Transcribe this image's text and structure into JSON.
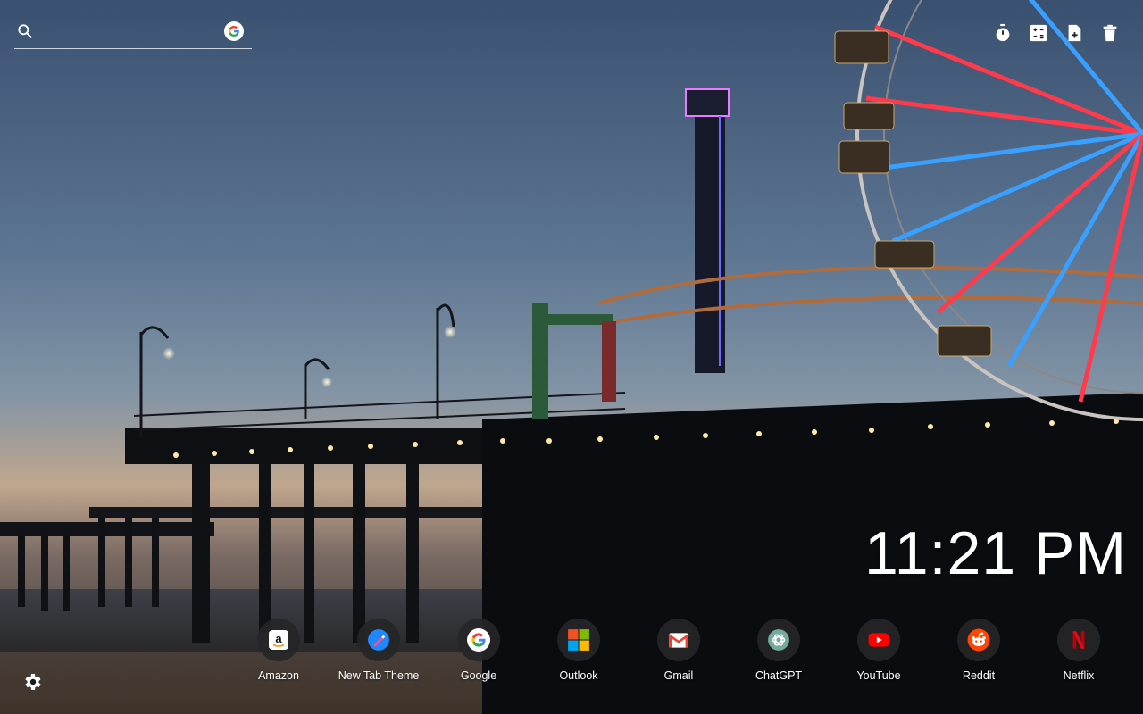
{
  "search": {
    "placeholder": "",
    "value": "",
    "engine_icon": "google-g-icon"
  },
  "tools": [
    {
      "name": "timer-icon"
    },
    {
      "name": "calculator-icon"
    },
    {
      "name": "new-note-icon"
    },
    {
      "name": "trash-icon"
    }
  ],
  "clock": {
    "time": "11:21 PM"
  },
  "shortcuts": [
    {
      "label": "Amazon",
      "icon": "amazon-icon"
    },
    {
      "label": "New Tab Theme",
      "icon": "new-tab-theme-icon"
    },
    {
      "label": "Google",
      "icon": "google-icon"
    },
    {
      "label": "Outlook",
      "icon": "outlook-icon"
    },
    {
      "label": "Gmail",
      "icon": "gmail-icon"
    },
    {
      "label": "ChatGPT",
      "icon": "chatgpt-icon"
    },
    {
      "label": "YouTube",
      "icon": "youtube-icon"
    },
    {
      "label": "Reddit",
      "icon": "reddit-icon"
    },
    {
      "label": "Netflix",
      "icon": "netflix-icon"
    }
  ],
  "settings": {
    "icon": "gear-icon"
  },
  "colors": {
    "sky_top": "#3c5272",
    "sky_horizon": "#c6aa90",
    "ferris_red": "#ff3a4a",
    "ferris_blue": "#3aa0ff",
    "light_glow": "#ffe9a8"
  }
}
